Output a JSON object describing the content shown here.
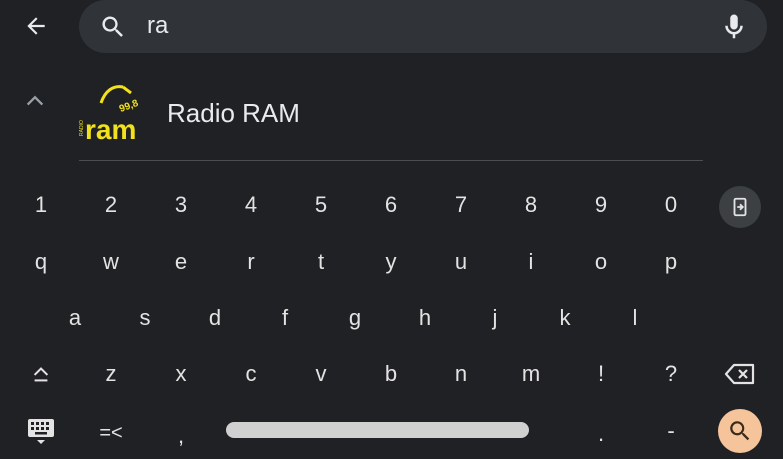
{
  "search": {
    "query": "ra"
  },
  "results": [
    {
      "label": "Radio RAM",
      "logo_text": "ram",
      "logo_small_text": "RADIO",
      "logo_freq": "99,8"
    }
  ],
  "keyboard": {
    "number_row": [
      "1",
      "2",
      "3",
      "4",
      "5",
      "6",
      "7",
      "8",
      "9",
      "0"
    ],
    "row1": [
      "q",
      "w",
      "e",
      "r",
      "t",
      "y",
      "u",
      "i",
      "o",
      "p"
    ],
    "row2": [
      "a",
      "s",
      "d",
      "f",
      "g",
      "h",
      "j",
      "k",
      "l"
    ],
    "row3": [
      "z",
      "x",
      "c",
      "v",
      "b",
      "n",
      "m",
      "!",
      "?"
    ],
    "symbols_label": "=<",
    "comma": ",",
    "period": ".",
    "dash": "-"
  },
  "icons": {
    "back": "arrow-left-icon",
    "search": "search-icon",
    "mic": "mic-icon",
    "collapse": "chevron-up-icon",
    "exit": "exit-keyboard-icon",
    "shift": "shift-icon",
    "backspace": "backspace-icon",
    "keyboard_switch": "keyboard-icon",
    "search_action": "search-icon"
  },
  "colors": {
    "background": "#1f2124",
    "search_field": "#303438",
    "logo_yellow": "#f2e21b",
    "search_action_bg": "#f5c49b"
  }
}
